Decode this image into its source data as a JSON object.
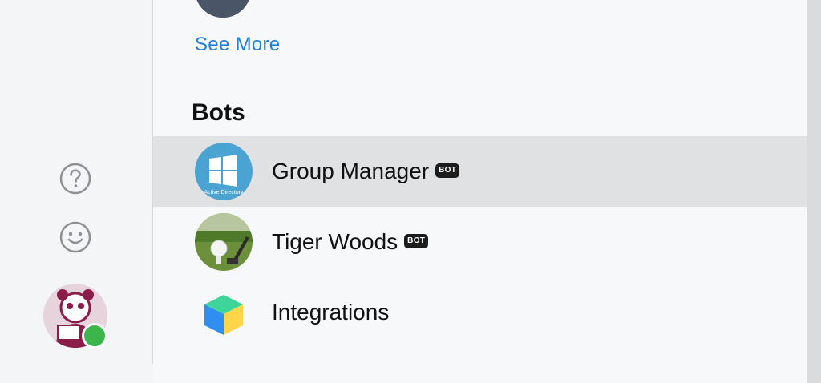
{
  "sidebar": {
    "help_icon": "question-circle-icon",
    "emoji_icon": "smiley-icon",
    "user_status_color": "#3cb54a"
  },
  "directory": {
    "see_more_label": "See More",
    "bots_section_title": "Bots",
    "bots": [
      {
        "name": "Group Manager",
        "badge": "BOT",
        "avatar_caption": "Active Directory",
        "selected": true
      },
      {
        "name": "Tiger Woods",
        "badge": "BOT",
        "selected": false
      },
      {
        "name": "Integrations",
        "badge": "",
        "selected": false
      }
    ]
  },
  "colors": {
    "link": "#1f7fd8",
    "selected_row": "#e0e1e3",
    "badge_bg": "#1c1c1c"
  }
}
